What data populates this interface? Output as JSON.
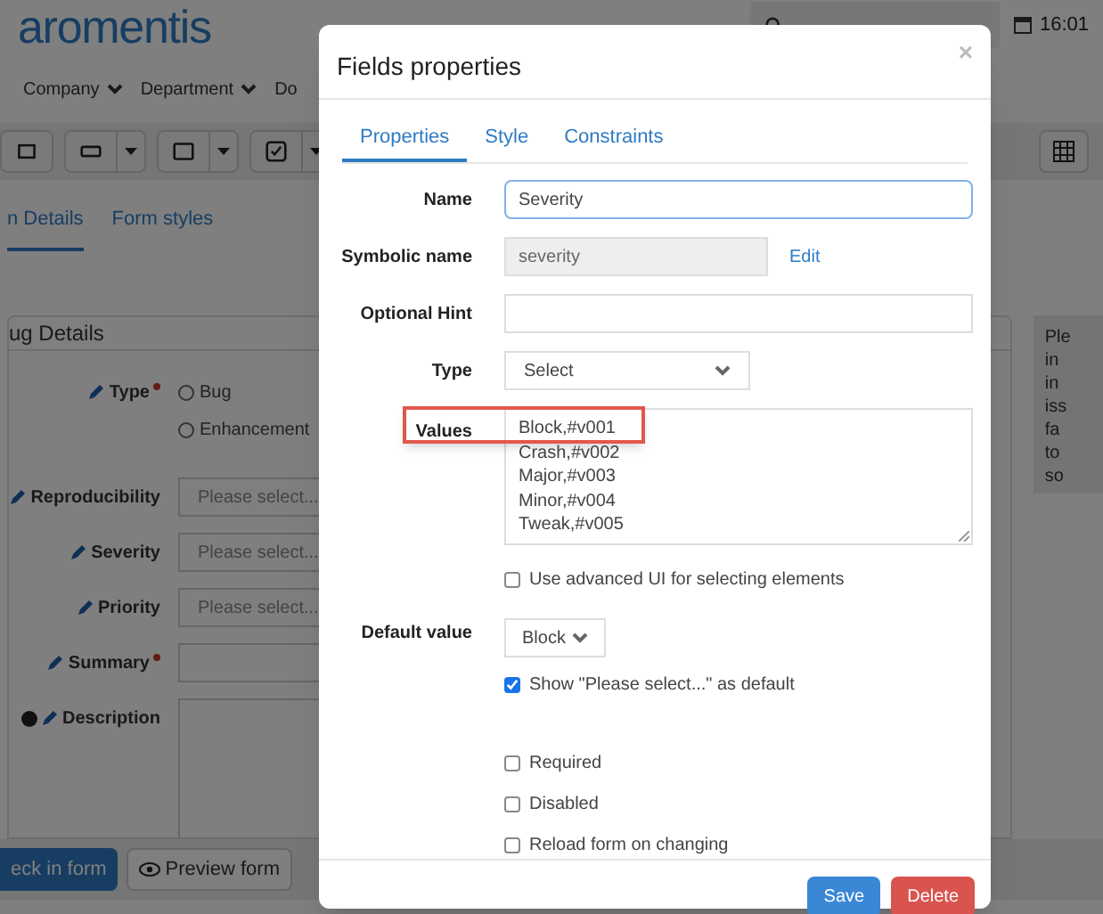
{
  "app": {
    "logo": "aromentis",
    "clock": "16:01",
    "menu": [
      {
        "label": "Company"
      },
      {
        "label": "Department"
      },
      {
        "label": "Do"
      }
    ],
    "tabs": [
      {
        "label": "n Details",
        "selected": true
      },
      {
        "label": "Form styles",
        "selected": false
      }
    ]
  },
  "form": {
    "title": "ug Details",
    "fields": [
      {
        "kind": "radio",
        "label": "Type",
        "required": true,
        "options": [
          "Bug",
          "Enhancement"
        ]
      },
      {
        "kind": "select",
        "label": "Reproducibility",
        "required": false,
        "placeholder": "Please select..."
      },
      {
        "kind": "select",
        "label": "Severity",
        "required": false,
        "placeholder": "Please select..."
      },
      {
        "kind": "select",
        "label": "Priority",
        "required": false,
        "placeholder": "Please select..."
      },
      {
        "kind": "text",
        "label": "Summary",
        "required": true
      },
      {
        "kind": "textarea",
        "label": "Description",
        "required": false
      }
    ],
    "help_text": [
      "Ple",
      "in",
      "in",
      "iss",
      "fa",
      "to",
      "so"
    ]
  },
  "footer": [
    {
      "kind": "primary",
      "label": "eck in form"
    },
    {
      "kind": "preview",
      "label": "Preview form"
    }
  ],
  "dialog": {
    "title": "Fields properties",
    "close": "×",
    "tabs": [
      {
        "label": "Properties",
        "selected": true
      },
      {
        "label": "Style",
        "selected": false
      },
      {
        "label": "Constraints",
        "selected": false
      }
    ],
    "name": {
      "label": "Name",
      "value": "Severity"
    },
    "symbolic_name": {
      "label": "Symbolic name",
      "value": "severity",
      "link": "Edit"
    },
    "hint": {
      "label": "Optional Hint"
    },
    "type": {
      "label": "Type",
      "value": "Select"
    },
    "values": {
      "label": "Values",
      "highlighted": true,
      "lines": [
        "Block,#v001",
        "Crash,#v002",
        "Major,#v003",
        "Minor,#v004",
        "Tweak,#v005"
      ]
    },
    "advanced_ui": {
      "label": "Use advanced UI for selecting elements",
      "checked": false
    },
    "default_value": {
      "label": "Default value",
      "value": "Block"
    },
    "show_placeholder": {
      "label": "Show \"Please select...\" as default",
      "checked": true
    },
    "flags": [
      {
        "label": "Required",
        "checked": false
      },
      {
        "label": "Disabled",
        "checked": false
      },
      {
        "label": "Reload form on changing",
        "checked": false
      }
    ],
    "buttons": [
      {
        "kind": "save",
        "label": "Save"
      },
      {
        "kind": "delete",
        "label": "Delete"
      }
    ]
  }
}
